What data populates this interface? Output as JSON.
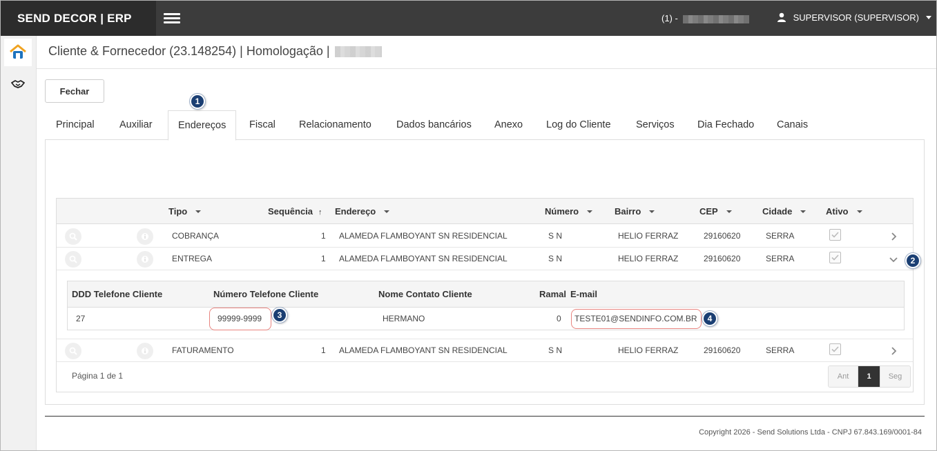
{
  "header": {
    "brand": "SEND DECOR | ERP",
    "company_prefix": "(1) -",
    "user": "SUPERVISOR (SUPERVISOR)"
  },
  "page": {
    "title": "Cliente & Fornecedor (23.148254) | Homologação |"
  },
  "toolbar": {
    "close_label": "Fechar"
  },
  "tabs": [
    {
      "label": "Principal"
    },
    {
      "label": "Auxiliar"
    },
    {
      "label": "Endereços"
    },
    {
      "label": "Fiscal"
    },
    {
      "label": "Relacionamento"
    },
    {
      "label": "Dados bancários"
    },
    {
      "label": "Anexo"
    },
    {
      "label": "Log do Cliente"
    },
    {
      "label": "Serviços"
    },
    {
      "label": "Dia Fechado"
    },
    {
      "label": "Canais"
    }
  ],
  "active_tab": "Endereços",
  "badges": [
    "1",
    "2",
    "3",
    "4"
  ],
  "grid": {
    "columns": [
      "Tipo",
      "Sequência",
      "Endereço",
      "Número",
      "Bairro",
      "CEP",
      "Cidade",
      "Ativo"
    ],
    "rows": [
      {
        "tipo": "COBRANÇA",
        "sequencia": "1",
        "endereco": "ALAMEDA FLAMBOYANT SN RESIDENCIAL",
        "numero": "S N",
        "bairro": "HELIO FERRAZ",
        "cep": "29160620",
        "cidade": "SERRA"
      },
      {
        "tipo": "ENTREGA",
        "sequencia": "1",
        "endereco": "ALAMEDA FLAMBOYANT SN RESIDENCIAL",
        "numero": "S N",
        "bairro": "HELIO FERRAZ",
        "cep": "29160620",
        "cidade": "SERRA"
      },
      {
        "tipo": "FATURAMENTO",
        "sequencia": "1",
        "endereco": "ALAMEDA FLAMBOYANT SN RESIDENCIAL",
        "numero": "S N",
        "bairro": "HELIO FERRAZ",
        "cep": "29160620",
        "cidade": "SERRA"
      }
    ],
    "detail": {
      "columns": [
        "DDD Telefone Cliente",
        "Número Telefone Cliente",
        "Nome Contato Cliente",
        "Ramal",
        "E-mail"
      ],
      "row": {
        "ddd": "27",
        "telefone": "99999-9999",
        "contato": "HERMANO",
        "ramal": "0",
        "email": "TESTE01@SENDINFO.COM.BR"
      }
    },
    "pager": {
      "text": "Página 1 de 1",
      "prev": "Ant",
      "current": "1",
      "next": "Seg"
    }
  },
  "footer": "Copyright 2026 - Send Solutions Ltda - CNPJ 67.843.169/0001-84"
}
